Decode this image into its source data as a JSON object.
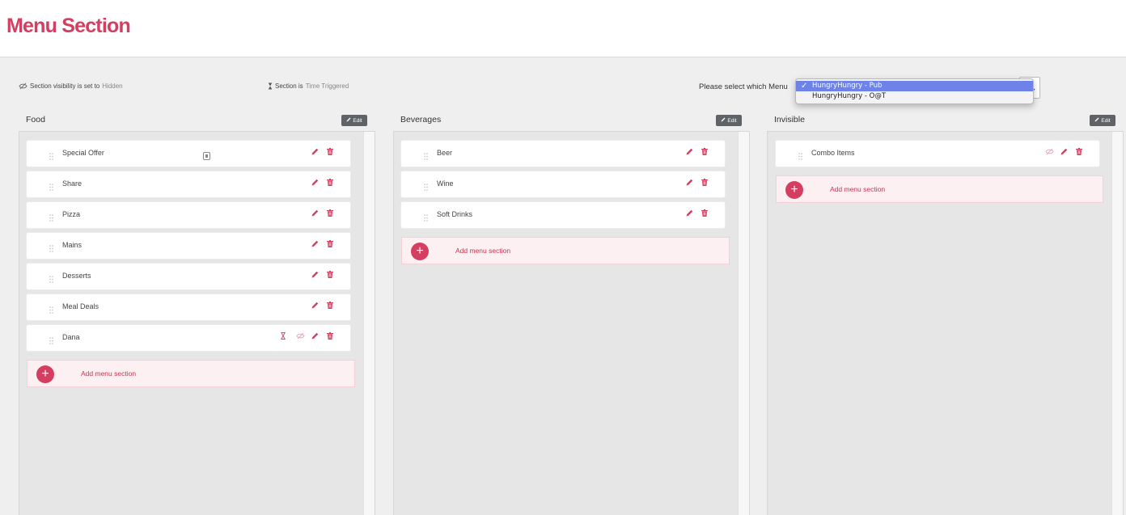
{
  "page": {
    "title": "Menu Section"
  },
  "legend": {
    "visibility_prefix": "Section visibility is set to",
    "visibility_value": "Hidden",
    "time_prefix": "Section is",
    "time_value": "Time Triggered"
  },
  "menu_select": {
    "label": "Please select which Menu",
    "options": [
      "HungryHungry - Pub",
      "HungryHungry - O@T"
    ],
    "selected": "HungryHungry - Pub"
  },
  "edit_label": "Edit",
  "add_label": "Add menu section",
  "colors": {
    "accent": "#d43e60",
    "edit_bg": "#5f6368",
    "panel_bg": "#e6e6e6"
  },
  "columns": [
    {
      "title": "Food",
      "items": [
        {
          "label": "Special Offer",
          "badge": "offer-icon"
        },
        {
          "label": "Share"
        },
        {
          "label": "Pizza"
        },
        {
          "label": "Mains"
        },
        {
          "label": "Desserts"
        },
        {
          "label": "Meal Deals"
        },
        {
          "label": "Dana",
          "time_triggered": true,
          "hidden": true
        }
      ]
    },
    {
      "title": "Beverages",
      "items": [
        {
          "label": "Beer"
        },
        {
          "label": "Wine"
        },
        {
          "label": "Soft Drinks"
        }
      ]
    },
    {
      "title": "Invisible",
      "items": [
        {
          "label": "Combo Items",
          "hidden": true
        }
      ]
    }
  ]
}
